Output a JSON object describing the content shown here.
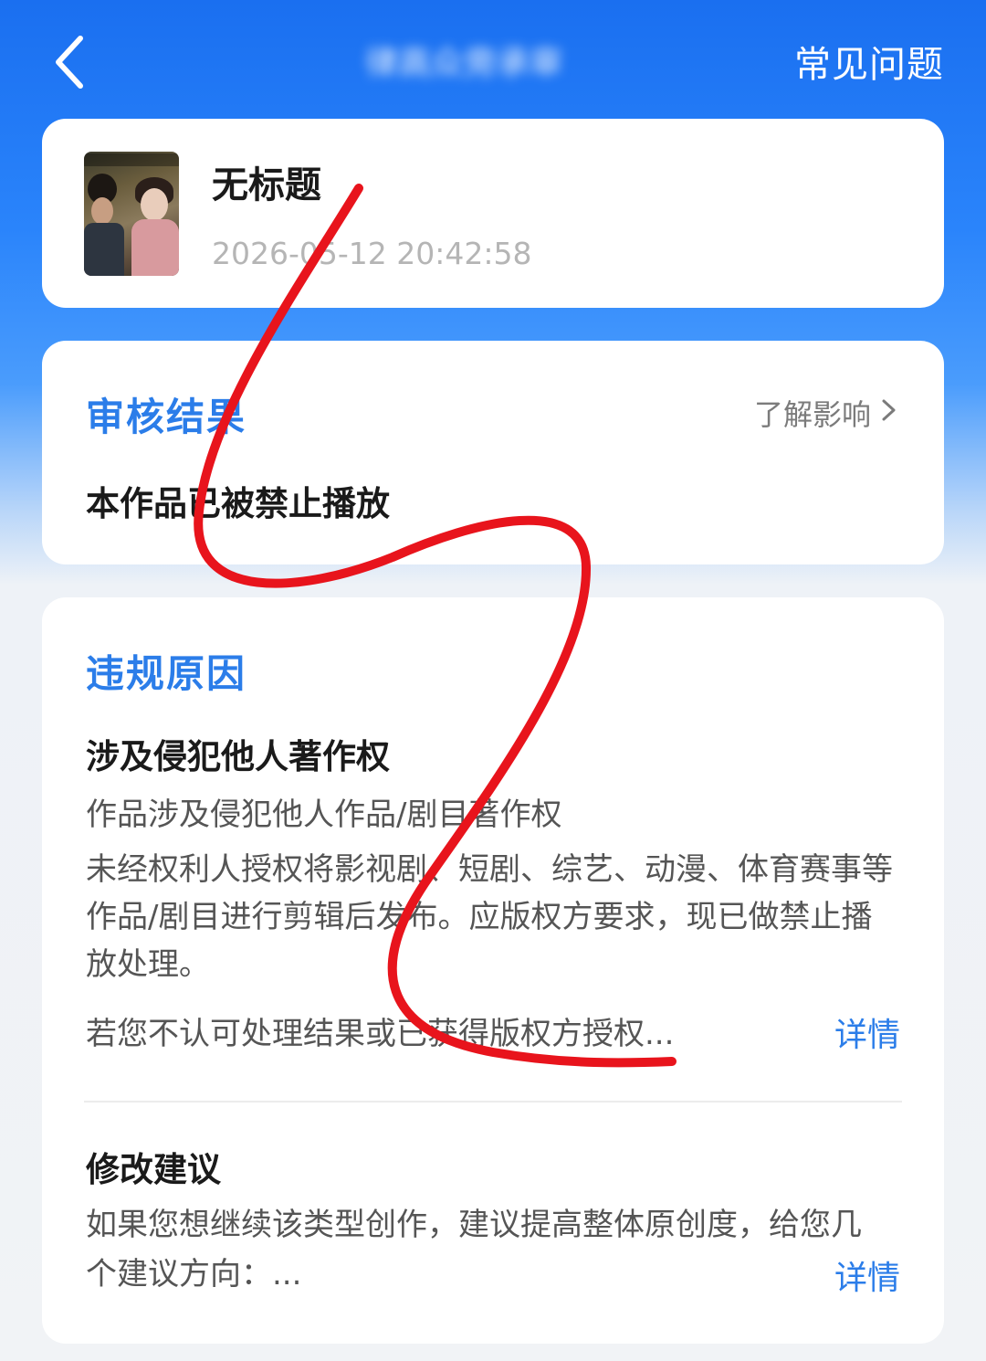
{
  "header": {
    "title": "律高众旁承审",
    "faq_label": "常见问题"
  },
  "video": {
    "title": "无标题",
    "time": "2026-05-12 20:42:58"
  },
  "result": {
    "section_title": "审核结果",
    "learn_more": "了解影响",
    "status": "本作品已被禁止播放"
  },
  "reason": {
    "section_title": "违规原因",
    "title": "涉及侵犯他人著作权",
    "subtitle": "作品涉及侵犯他人作品/剧目著作权",
    "description": "未经权利人授权将影视剧、短剧、综艺、动漫、体育赛事等作品/剧目进行剪辑后发布。应版权方要求，现已做禁止播放处理。",
    "appeal": "若您不认可处理结果或已获得版权方授权...",
    "detail_label": "详情"
  },
  "suggestion": {
    "title": "修改建议",
    "text": "如果您想继续该类型创作，建议提高整体原创度，给您几个建议方向：...",
    "detail_label": "详情"
  },
  "colors": {
    "accent": "#2b7de9",
    "header_blue": "#1a6ff0",
    "scribble": "#e8141c"
  }
}
